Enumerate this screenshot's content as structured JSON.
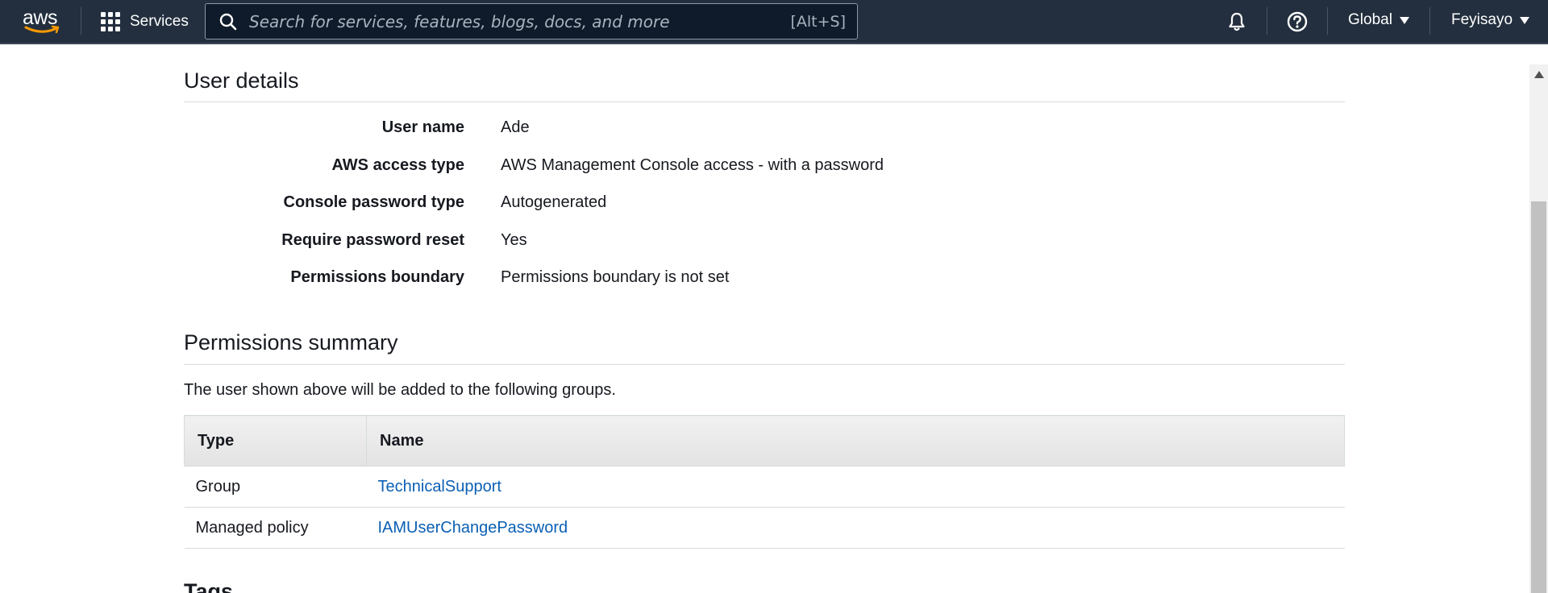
{
  "topnav": {
    "logo_text": "aws",
    "services_label": "Services",
    "search_placeholder": "Search for services, features, blogs, docs, and more",
    "search_shortcut": "[Alt+S]",
    "region": "Global",
    "account": "Feyisayo",
    "icons": [
      "aws-logo",
      "grid-icon",
      "search-icon",
      "bell-icon",
      "help-icon",
      "caret-down-icon"
    ]
  },
  "user_details": {
    "title": "User details",
    "rows": [
      {
        "label": "User name",
        "value": "Ade"
      },
      {
        "label": "AWS access type",
        "value": "AWS Management Console access - with a password"
      },
      {
        "label": "Console password type",
        "value": "Autogenerated"
      },
      {
        "label": "Require password reset",
        "value": "Yes"
      },
      {
        "label": "Permissions boundary",
        "value": "Permissions boundary is not set"
      }
    ]
  },
  "permissions_summary": {
    "title": "Permissions summary",
    "description": "The user shown above will be added to the following groups.",
    "columns": [
      "Type",
      "Name"
    ],
    "rows": [
      {
        "type": "Group",
        "name": "TechnicalSupport"
      },
      {
        "type": "Managed policy",
        "name": "IAMUserChangePassword"
      }
    ]
  },
  "tags": {
    "title": "Tags"
  },
  "colors": {
    "nav_bg": "#232f3e",
    "link": "#0a5fb4",
    "text": "#16191f",
    "divider": "#d5dbdb"
  }
}
